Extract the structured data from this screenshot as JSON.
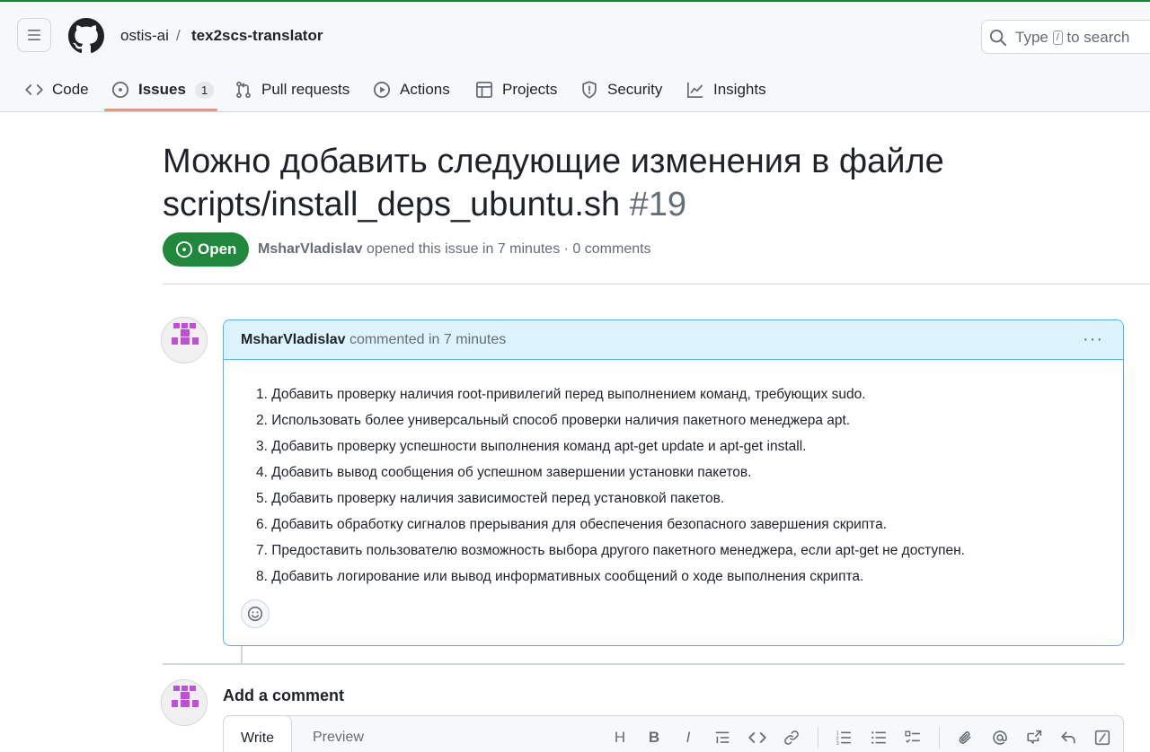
{
  "header": {
    "owner": "ostis-ai",
    "separator": "/",
    "repo": "tex2scs-translator",
    "search_prefix": "Type",
    "search_key": "/",
    "search_suffix": "to search"
  },
  "nav": {
    "tabs": [
      {
        "label": "Code",
        "icon": "code-icon"
      },
      {
        "label": "Issues",
        "icon": "issue-opened-icon",
        "counter": "1",
        "selected": true
      },
      {
        "label": "Pull requests",
        "icon": "git-pull-request-icon"
      },
      {
        "label": "Actions",
        "icon": "play-icon"
      },
      {
        "label": "Projects",
        "icon": "table-icon"
      },
      {
        "label": "Security",
        "icon": "shield-icon"
      },
      {
        "label": "Insights",
        "icon": "graph-icon"
      }
    ]
  },
  "issue": {
    "title": "Можно добавить следующие изменения в файле scripts/install_deps_ubuntu.sh",
    "number": "#19",
    "state": "Open",
    "author": "MsharVladislav",
    "meta_text": "opened this issue in 7 minutes · 0 comments"
  },
  "comment": {
    "author": "MsharVladislav",
    "meta": "commented in 7 minutes",
    "items": [
      "1. Добавить проверку наличия root-привилегий перед выполнением команд, требующих sudo.",
      "2. Использовать более универсальный способ проверки наличия пакетного менеджера apt.",
      "3. Добавить проверку успешности выполнения команд apt-get update и apt-get install.",
      "4. Добавить вывод сообщения об успешном завершении установки пакетов.",
      "5. Добавить проверку наличия зависимостей перед установкой пакетов.",
      "6. Добавить обработку сигналов прерывания для обеспечения безопасного завершения скрипта.",
      "7. Предоставить пользователю возможность выбора другого пакетного менеджера, если apt-get не доступен.",
      "8. Добавить логирование или вывод информативных сообщений о ходе выполнения скрипта."
    ]
  },
  "add_comment": {
    "heading": "Add a comment",
    "write_tab": "Write",
    "preview_tab": "Preview",
    "toolbar": {
      "heading": "H",
      "bold": "B",
      "italic": "I"
    }
  },
  "colors": {
    "open_green": "#1f883d",
    "accent_underline": "#fd8c73",
    "comment_header_bg": "#ddf4ff",
    "comment_border": "#54aeff",
    "avatar_pink": "#c04fd8"
  }
}
